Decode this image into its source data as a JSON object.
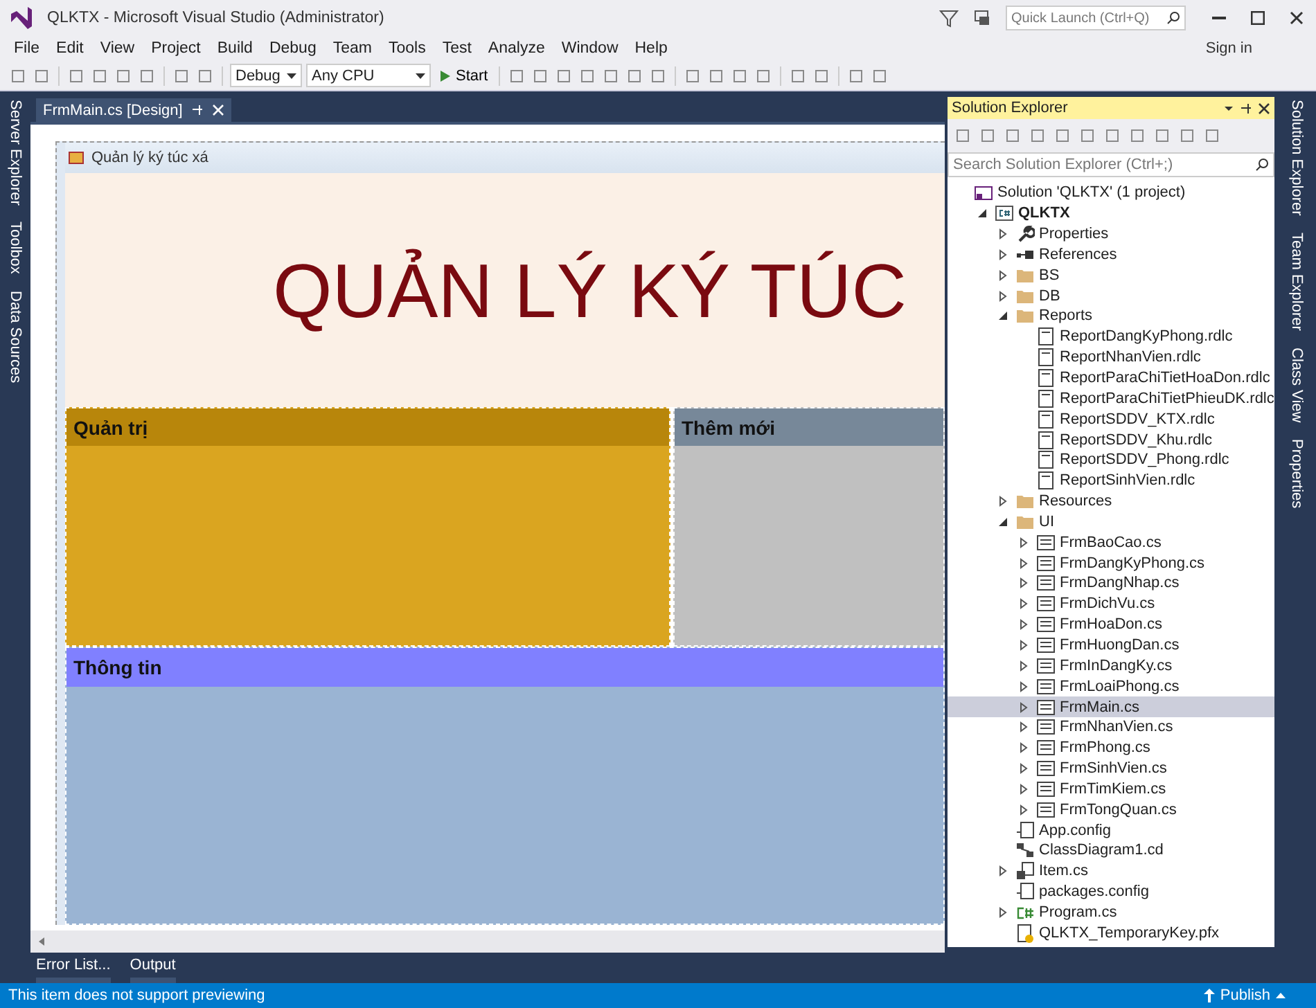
{
  "window": {
    "title": "QLKTX - Microsoft Visual Studio (Administrator)"
  },
  "quick_launch": {
    "placeholder": "Quick Launch (Ctrl+Q)"
  },
  "menu": [
    "File",
    "Edit",
    "View",
    "Project",
    "Build",
    "Debug",
    "Team",
    "Tools",
    "Test",
    "Analyze",
    "Window",
    "Help"
  ],
  "account": {
    "label": "Sign in"
  },
  "toolbar": {
    "configuration": "Debug",
    "platform": "Any CPU",
    "start": "Start"
  },
  "left_tool_tabs": [
    "Server Explorer",
    "Toolbox",
    "Data Sources"
  ],
  "document_tab": {
    "title": "FrmMain.cs [Design]"
  },
  "form": {
    "title": "Quản lý ký túc xá",
    "banner": "QUẢN LÝ KÝ TÚC",
    "panels": [
      {
        "title": "Quản trị",
        "kind": "admin"
      },
      {
        "title": "Thêm mới",
        "kind": "add"
      },
      {
        "title": "Thông tin",
        "kind": "info"
      }
    ]
  },
  "solution_explorer": {
    "title": "Solution Explorer",
    "search": {
      "placeholder": "Search Solution Explorer (Ctrl+;)"
    },
    "tree": [
      {
        "label": "Solution 'QLKTX' (1 project)",
        "kind": "solution",
        "selected": false,
        "children": [
          {
            "label": "QLKTX",
            "kind": "project",
            "expanded": true,
            "selected": false,
            "children": [
              {
                "label": "Properties",
                "kind": "properties",
                "expanded": false,
                "selected": false
              },
              {
                "label": "References",
                "kind": "references",
                "expanded": false,
                "selected": false
              },
              {
                "label": "BS",
                "kind": "folder",
                "expanded": false,
                "selected": false
              },
              {
                "label": "DB",
                "kind": "folder",
                "expanded": false,
                "selected": false
              },
              {
                "label": "Reports",
                "kind": "folder",
                "expanded": true,
                "selected": false,
                "children": [
                  {
                    "label": "ReportDangKyPhong.rdlc",
                    "kind": "report",
                    "selected": false
                  },
                  {
                    "label": "ReportNhanVien.rdlc",
                    "kind": "report",
                    "selected": false
                  },
                  {
                    "label": "ReportParaChiTietHoaDon.rdlc",
                    "kind": "report",
                    "selected": false
                  },
                  {
                    "label": "ReportParaChiTietPhieuDK.rdlc",
                    "kind": "report",
                    "selected": false
                  },
                  {
                    "label": "ReportSDDV_KTX.rdlc",
                    "kind": "report",
                    "selected": false
                  },
                  {
                    "label": "ReportSDDV_Khu.rdlc",
                    "kind": "report",
                    "selected": false
                  },
                  {
                    "label": "ReportSDDV_Phong.rdlc",
                    "kind": "report",
                    "selected": false
                  },
                  {
                    "label": "ReportSinhVien.rdlc",
                    "kind": "report",
                    "selected": false
                  }
                ]
              },
              {
                "label": "Resources",
                "kind": "folder",
                "expanded": false,
                "selected": false
              },
              {
                "label": "UI",
                "kind": "folder",
                "expanded": true,
                "selected": false,
                "children": [
                  {
                    "label": "FrmBaoCao.cs",
                    "kind": "form",
                    "expanded": false,
                    "selected": false
                  },
                  {
                    "label": "FrmDangKyPhong.cs",
                    "kind": "form",
                    "expanded": false,
                    "selected": false
                  },
                  {
                    "label": "FrmDangNhap.cs",
                    "kind": "form",
                    "expanded": false,
                    "selected": false
                  },
                  {
                    "label": "FrmDichVu.cs",
                    "kind": "form",
                    "expanded": false,
                    "selected": false
                  },
                  {
                    "label": "FrmHoaDon.cs",
                    "kind": "form",
                    "expanded": false,
                    "selected": false
                  },
                  {
                    "label": "FrmHuongDan.cs",
                    "kind": "form",
                    "expanded": false,
                    "selected": false
                  },
                  {
                    "label": "FrmInDangKy.cs",
                    "kind": "form",
                    "expanded": false,
                    "selected": false
                  },
                  {
                    "label": "FrmLoaiPhong.cs",
                    "kind": "form",
                    "expanded": false,
                    "selected": false
                  },
                  {
                    "label": "FrmMain.cs",
                    "kind": "form",
                    "expanded": false,
                    "selected": true
                  },
                  {
                    "label": "FrmNhanVien.cs",
                    "kind": "form",
                    "expanded": false,
                    "selected": false
                  },
                  {
                    "label": "FrmPhong.cs",
                    "kind": "form",
                    "expanded": false,
                    "selected": false
                  },
                  {
                    "label": "FrmSinhVien.cs",
                    "kind": "form",
                    "expanded": false,
                    "selected": false
                  },
                  {
                    "label": "FrmTimKiem.cs",
                    "kind": "form",
                    "expanded": false,
                    "selected": false
                  },
                  {
                    "label": "FrmTongQuan.cs",
                    "kind": "form",
                    "expanded": false,
                    "selected": false
                  }
                ]
              },
              {
                "label": "App.config",
                "kind": "config",
                "selected": false
              },
              {
                "label": "ClassDiagram1.cd",
                "kind": "diagram",
                "selected": false
              },
              {
                "label": "Item.cs",
                "kind": "item",
                "expanded": false,
                "selected": false
              },
              {
                "label": "packages.config",
                "kind": "config",
                "selected": false
              },
              {
                "label": "Program.cs",
                "kind": "csharp",
                "expanded": false,
                "selected": false
              },
              {
                "label": "QLKTX_TemporaryKey.pfx",
                "kind": "key",
                "selected": false
              }
            ]
          }
        ]
      }
    ]
  },
  "right_tool_tabs": [
    "Solution Explorer",
    "Team Explorer",
    "Class View",
    "Properties"
  ],
  "bottom_tabs": [
    "Error List...",
    "Output"
  ],
  "status_bar": {
    "message": "This item does not support previewing",
    "publish": "Publish"
  }
}
